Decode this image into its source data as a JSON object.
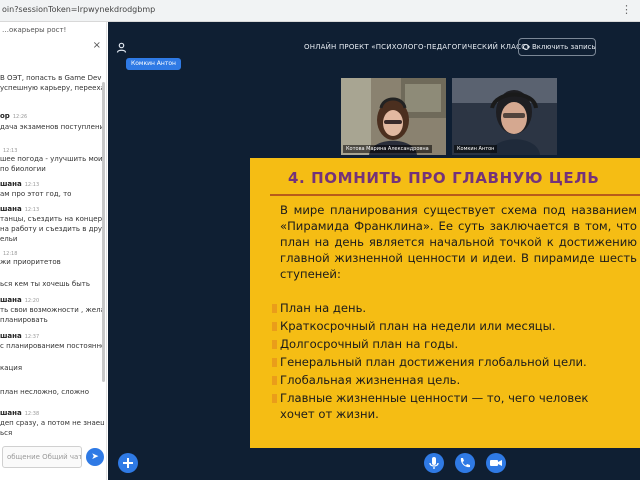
{
  "browser": {
    "url": "oin?sessionToken=lrpwynekdrodgbmp",
    "menu_icon": "⋮"
  },
  "chat": {
    "top_text": "…окарьеры рост!",
    "close_icon": "×",
    "messages": [
      {
        "text": "В ОЭТ, попасть в Game Dev"
      },
      {
        "text": "успешную карьеру, переехать"
      },
      {
        "who": "ор",
        "time": "12:26"
      },
      {
        "text": "дача экзаменов поступление в"
      },
      {
        "time": "12:13"
      },
      {
        "text": "шее погода - улучшить мои"
      },
      {
        "text": "по биологии"
      },
      {
        "who": "шана",
        "time": "12:13"
      },
      {
        "text": "ам про этот год, то"
      },
      {
        "who": "шана",
        "time": "12:13"
      },
      {
        "text": "танцы, съездить на концерт,"
      },
      {
        "text": "на работу и съездить в другой"
      },
      {
        "text": "ельи"
      },
      {
        "time": "12:18"
      },
      {
        "text": "жи приоритетов"
      },
      {
        "text": "ься кем ты хочешь быть"
      },
      {
        "who": "шана",
        "time": "12:20"
      },
      {
        "text": "ть свои возможности , желание"
      },
      {
        "text": "планировать"
      },
      {
        "who": "шана",
        "time": "12:37"
      },
      {
        "text": "с планированием постоянно"
      },
      {
        "text": "кация"
      },
      {
        "text": "план несложно, сложно"
      },
      {
        "who": "шана",
        "time": "12:38"
      },
      {
        "text": "деп сразу, а потом не знаешь,"
      },
      {
        "text": "ься"
      }
    ],
    "input_placeholder": "общение Общий чат",
    "send_icon": "➤"
  },
  "stage": {
    "user_icon": "person-icon",
    "title": "ОНЛАЙН ПРОЕКТ «ПСИХОЛОГО-ПЕДАГОГИЧЕСКИЙ КЛАСС»",
    "record_label": "Включить запись",
    "presenter_label": "Комкин Антон",
    "cams": [
      {
        "name": "Котова Марина Александровна"
      },
      {
        "name": "Комкин Антон"
      }
    ]
  },
  "slide": {
    "title": "4. ПОМНИТЬ ПРО ГЛАВНУЮ ЦЕЛЬ",
    "intro": "В мире планирования существует схема под названием «Пирамида Франклина». Ее суть заключается в том, что план на день является начальной точкой к достижению главной жизненной ценности и идеи. В пирамиде шесть ступеней:",
    "items": [
      "План на день.",
      "Краткосрочный план на недели или месяцы.",
      "Долгосрочный план на годы.",
      "Генеральный план достижения глобальной цели.",
      "Глобальная жизненная цель.",
      "Главные жизненные ценности — то, чего человек",
      "хочет от жизни."
    ]
  },
  "colors": {
    "stage_bg": "#0f1f33",
    "slide_bg": "#f5bd14",
    "slide_title": "#74327a",
    "accent": "#2f7ae5"
  }
}
